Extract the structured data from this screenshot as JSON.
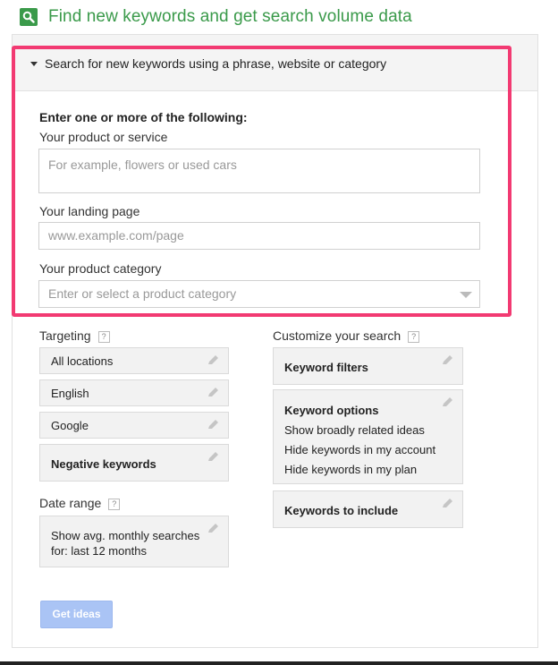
{
  "header": {
    "title": "Find new keywords and get search volume data",
    "icon": "search-icon",
    "accent_color": "#3a9a4a"
  },
  "section": {
    "title": "Search for new keywords using a phrase, website or category",
    "instructions": "Enter one or more of the following:",
    "product": {
      "label": "Your product or service",
      "placeholder": "For example, flowers or used cars"
    },
    "landing": {
      "label": "Your landing page",
      "placeholder": "www.example.com/page"
    },
    "category": {
      "label": "Your product category",
      "placeholder": "Enter or select a product category"
    },
    "highlight_color": "#f23a72"
  },
  "targeting": {
    "label": "Targeting",
    "help": "?",
    "items": [
      "All locations",
      "English",
      "Google"
    ],
    "negative": "Negative keywords"
  },
  "date_range": {
    "label": "Date range",
    "help": "?",
    "line1": "Show avg. monthly searches",
    "line2": "for: last 12 months"
  },
  "customize": {
    "label": "Customize your search",
    "help": "?",
    "filters": "Keyword filters",
    "options": {
      "title": "Keyword options",
      "items": [
        "Show broadly related ideas",
        "Hide keywords in my account",
        "Hide keywords in my plan"
      ]
    },
    "include": "Keywords to include"
  },
  "actions": {
    "get_ideas": "Get ideas"
  }
}
